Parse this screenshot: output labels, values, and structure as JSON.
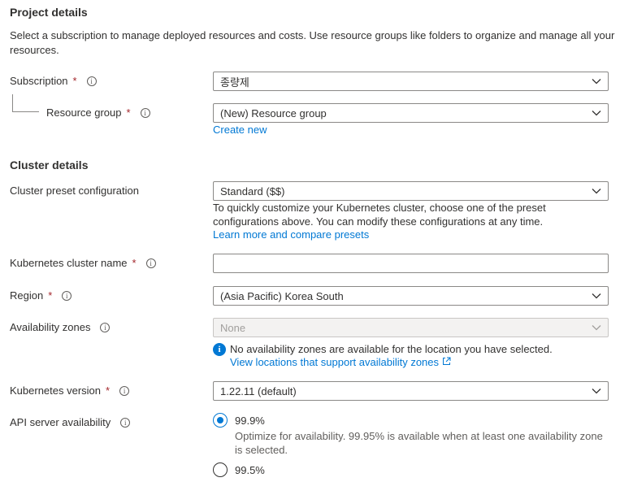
{
  "project": {
    "title": "Project details",
    "description": "Select a subscription to manage deployed resources and costs. Use resource groups like folders to organize and manage all your resources.",
    "subscription": {
      "label": "Subscription",
      "required": "*",
      "value": "종량제"
    },
    "resource_group": {
      "label": "Resource group",
      "required": "*",
      "value": "(New) Resource group",
      "create_new": "Create new"
    }
  },
  "cluster": {
    "title": "Cluster details",
    "preset": {
      "label": "Cluster preset configuration",
      "value": "Standard ($$)",
      "helper": "To quickly customize your Kubernetes cluster, choose one of the preset configurations above. You can modify these configurations at any time.",
      "link": "Learn more and compare presets"
    },
    "name": {
      "label": "Kubernetes cluster name",
      "required": "*",
      "value": ""
    },
    "region": {
      "label": "Region",
      "required": "*",
      "value": "(Asia Pacific) Korea South"
    },
    "zones": {
      "label": "Availability zones",
      "value": "None",
      "notice": "No availability zones are available for the location you have selected.",
      "link": "View locations that support availability zones"
    },
    "version": {
      "label": "Kubernetes version",
      "required": "*",
      "value": "1.22.11 (default)"
    },
    "api": {
      "label": "API server availability",
      "options": [
        {
          "label": "99.9%",
          "description": "Optimize for availability. 99.95% is available when at least one availability zone is selected.",
          "selected": true
        },
        {
          "label": "99.5%",
          "selected": false
        }
      ]
    }
  },
  "icons": {
    "info": "i",
    "info_fill": "i"
  }
}
